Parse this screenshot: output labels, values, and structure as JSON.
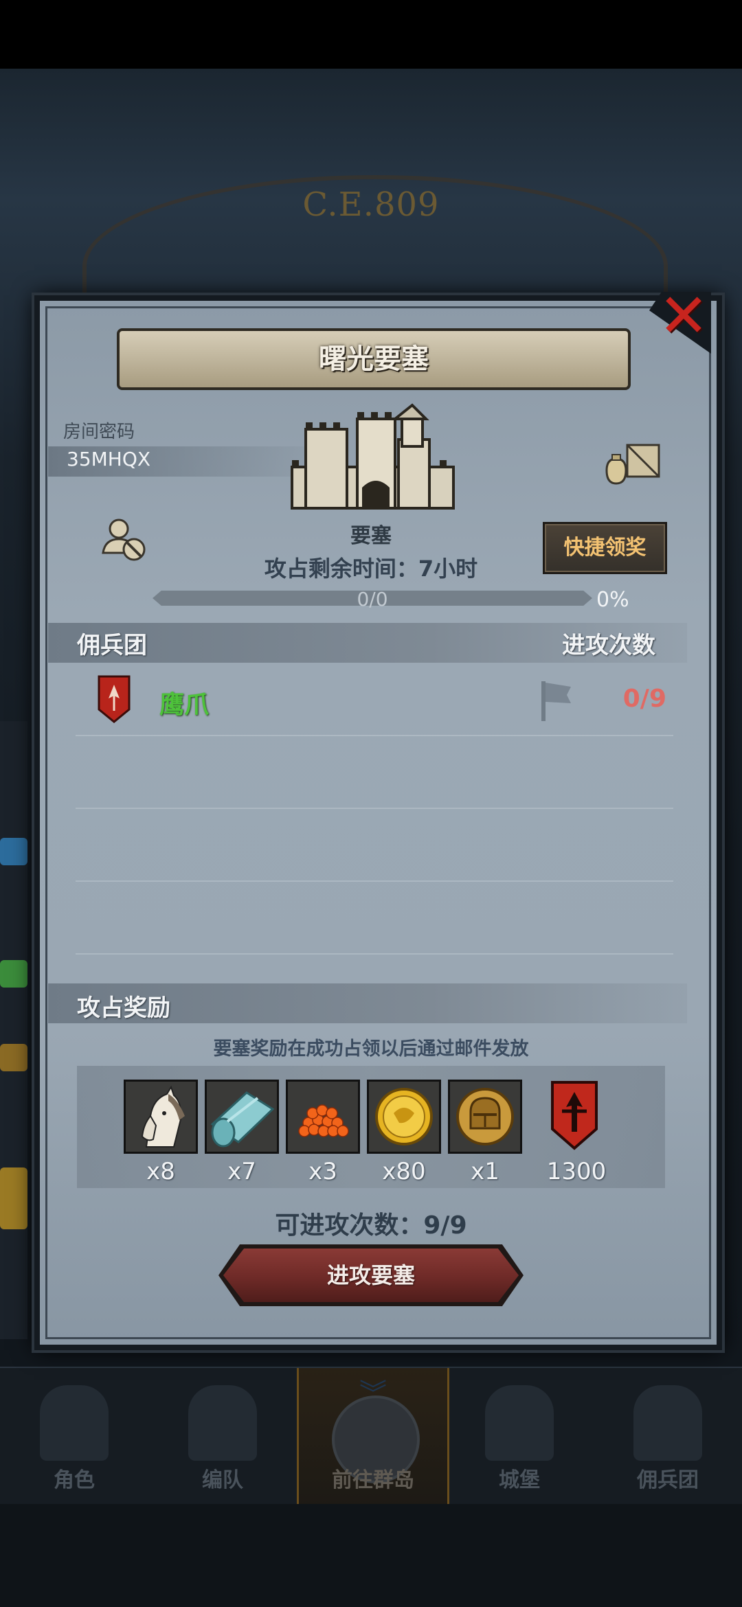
{
  "background": {
    "era_text": "C.E.809"
  },
  "dialog": {
    "title": "曙光要塞",
    "room_label": "房间密码",
    "room_code": "35MHQX",
    "building_name": "要塞",
    "time_remaining": "攻占剩余时间：7小时",
    "progress_text": "0/0",
    "progress_percent": "0%",
    "progress_fraction": 0,
    "quick_claim_label": "快捷领奖",
    "merc_header": "佣兵团",
    "attack_count_header": "进攻次数",
    "mercs": [
      {
        "name": "鹰爪",
        "count": "0/9"
      }
    ],
    "reward_header": "攻占奖励",
    "reward_note": "要塞奖励在成功占领以后通过邮件发放",
    "rewards": [
      {
        "icon": "horse-icon",
        "count": "x8"
      },
      {
        "icon": "cloth-icon",
        "count": "x7"
      },
      {
        "icon": "caviar-icon",
        "count": "x3"
      },
      {
        "icon": "gold-coin-icon",
        "count": "x80"
      },
      {
        "icon": "helmet-coin-icon",
        "count": "x1"
      },
      {
        "icon": "guild-banner-icon",
        "count": "1300"
      }
    ],
    "attempts": "可进攻次数：9/9",
    "attack_button": "进攻要塞"
  },
  "nav": {
    "items": [
      {
        "label": "角色"
      },
      {
        "label": "编队"
      },
      {
        "label": "前往群岛"
      },
      {
        "label": "城堡"
      },
      {
        "label": "佣兵团"
      }
    ]
  },
  "colors": {
    "merc_name": "#4ec23b",
    "attack_count": "#e06a64",
    "quick_claim_text": "#f3c272",
    "close_x": "#c8241e"
  }
}
